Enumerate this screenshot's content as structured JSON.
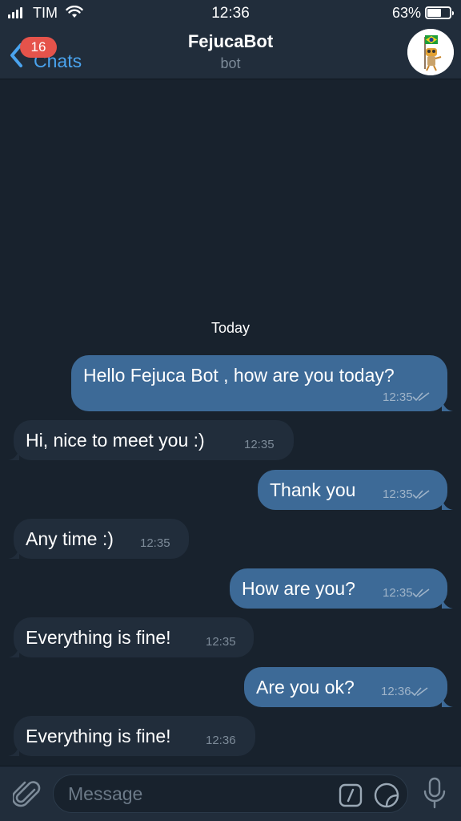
{
  "status_bar": {
    "carrier": "TIM",
    "time": "12:36",
    "battery_percent": "63%",
    "battery_level": 0.63,
    "icons": [
      "signal-icon",
      "wifi-icon",
      "battery-icon"
    ]
  },
  "header": {
    "back_label": "Chats",
    "unread_badge": "16",
    "title": "FejucaBot",
    "subtitle": "bot",
    "icons": [
      "back-chevron-icon",
      "bot-avatar"
    ]
  },
  "chat": {
    "date_separator": "Today",
    "messages": [
      {
        "direction": "out",
        "text": "Hello Fejuca Bot , how are you today?",
        "time": "12:35",
        "status": "read"
      },
      {
        "direction": "in",
        "text": "Hi, nice to meet you :)",
        "time": "12:35"
      },
      {
        "direction": "out",
        "text": "Thank you",
        "time": "12:35",
        "status": "read"
      },
      {
        "direction": "in",
        "text": "Any time :)",
        "time": "12:35"
      },
      {
        "direction": "out",
        "text": "How are you?",
        "time": "12:35",
        "status": "read"
      },
      {
        "direction": "in",
        "text": "Everything is fine!",
        "time": "12:35"
      },
      {
        "direction": "out",
        "text": "Are you ok?",
        "time": "12:36",
        "status": "read"
      },
      {
        "direction": "in",
        "text": "Everything is fine!",
        "time": "12:36"
      }
    ]
  },
  "input_bar": {
    "placeholder": "Message",
    "value": "",
    "icons": [
      "paperclip-icon",
      "bot-command-icon",
      "sticker-icon",
      "microphone-icon"
    ]
  },
  "colors": {
    "background": "#18222d",
    "bar": "#212d3b",
    "outgoing_bubble": "#3d6a97",
    "incoming_bubble": "#212d3b",
    "accent": "#4aa3ee",
    "badge": "#e5534b"
  }
}
